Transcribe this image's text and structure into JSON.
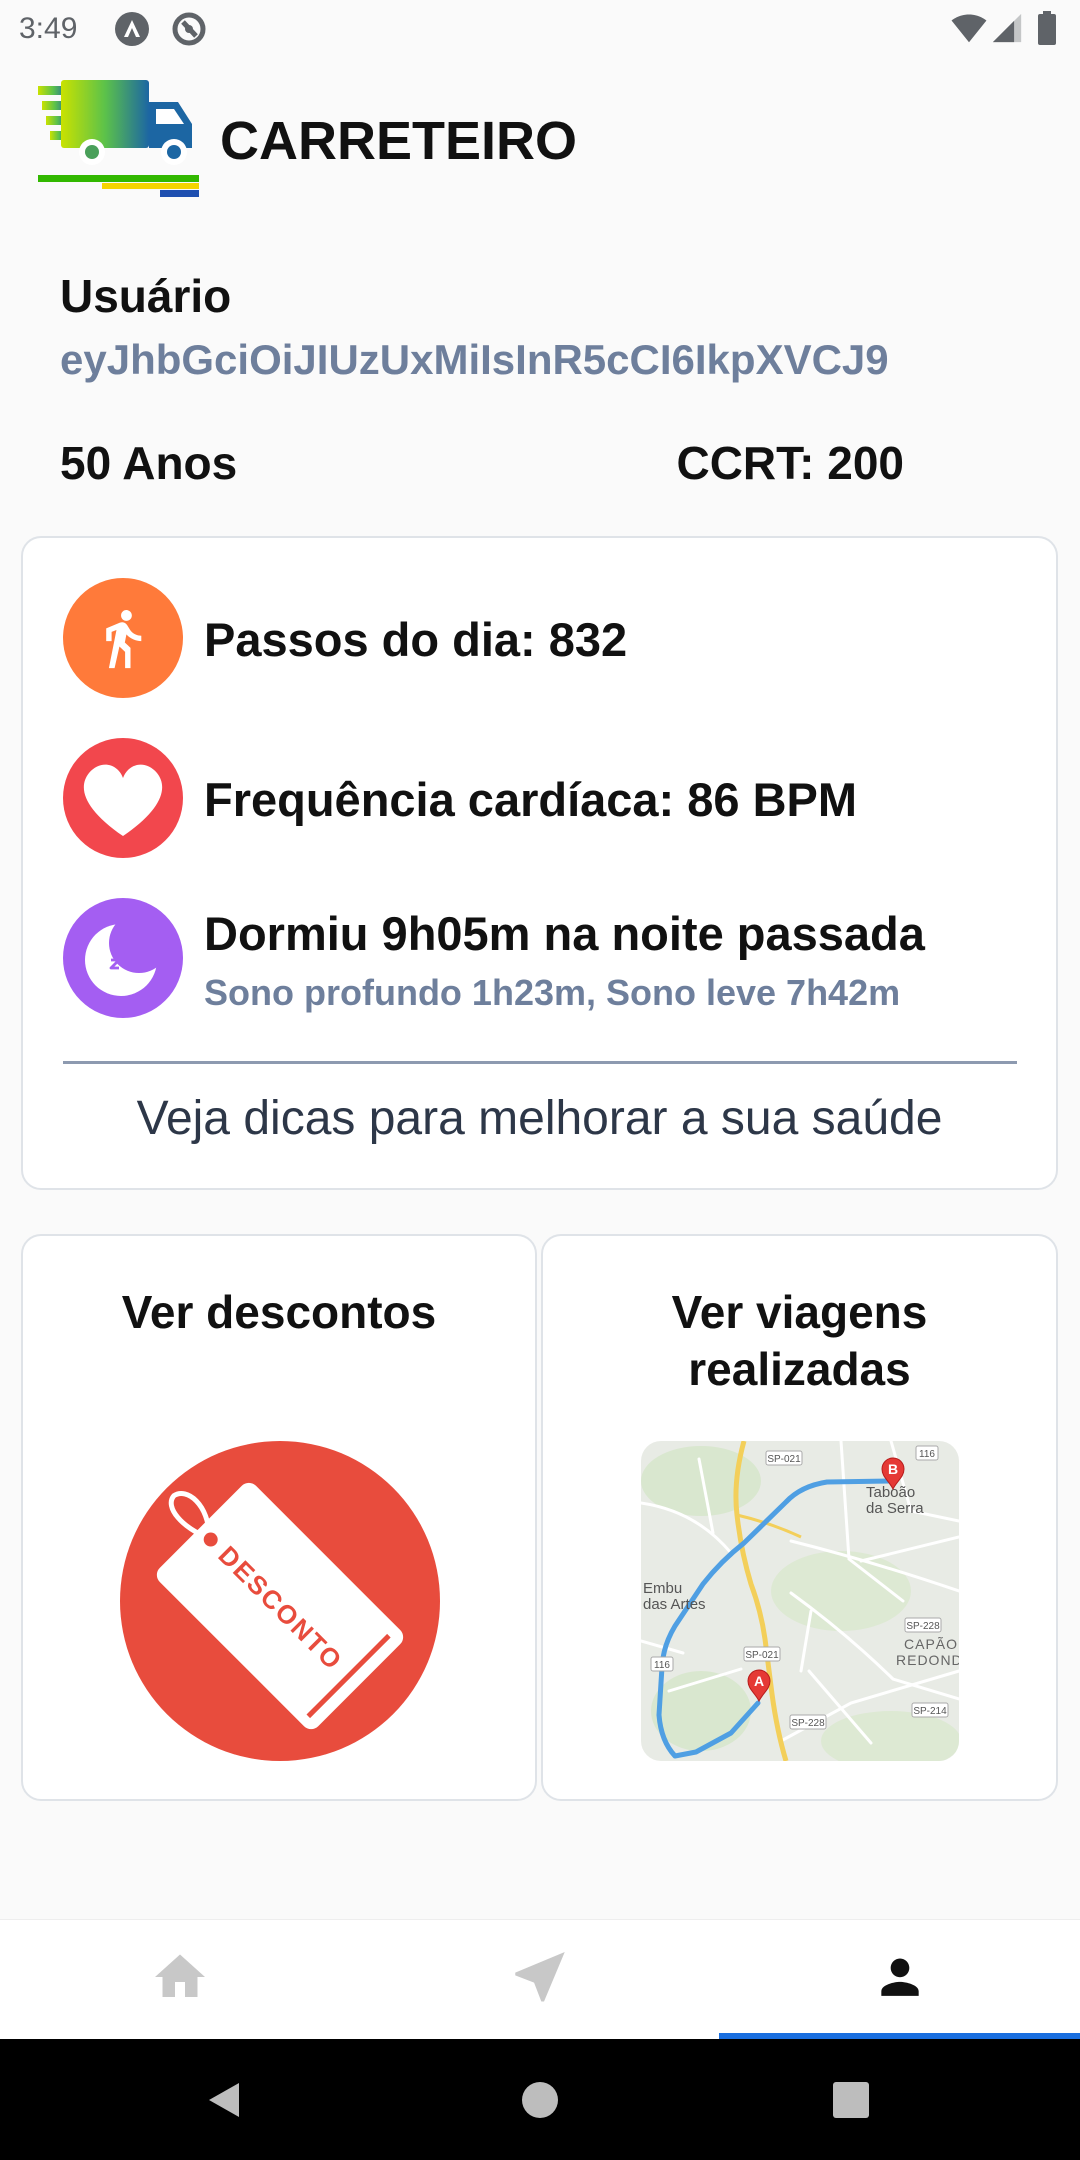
{
  "status_bar": {
    "time": "3:49",
    "icons": [
      "app-notification-icon",
      "sync-notification-icon",
      "wifi-icon",
      "cell-signal-icon",
      "battery-icon"
    ]
  },
  "header": {
    "logo_icon": "truck-logo-icon",
    "title": "CARRETEIRO"
  },
  "profile": {
    "user_label": "Usuário",
    "user_id": "eyJhbGciOiJIUzUxMiIsInR5cCI6IkpXVCJ9",
    "age": "50 Anos",
    "ccrt": "CCRT: 200"
  },
  "health": {
    "steps": {
      "icon": "walking-person-icon",
      "color": "#ff7a3a",
      "text": "Passos do dia: 832"
    },
    "heart_rate": {
      "icon": "heart-icon",
      "color": "#f2474d",
      "text": "Frequência cardíaca: 86 BPM"
    },
    "sleep": {
      "icon": "moon-icon",
      "color": "#a45ef2",
      "text": "Dormiu 9h05m na noite passada",
      "detail": "Sono profundo 1h23m, Sono leve 7h42m"
    },
    "tips_link": "Veja dicas para melhorar a sua saúde"
  },
  "shortcuts": {
    "discounts": {
      "title": "Ver descontos",
      "icon": "discount-tag-icon",
      "tag_text": "DESCONTO",
      "color": "#e84c3d"
    },
    "trips": {
      "title": "Ver viagens realizadas",
      "icon": "trip-route-map",
      "map": {
        "markers": {
          "start": "A",
          "end": "B"
        },
        "places": {
          "taboao_line1": "Taboão",
          "taboao_line2": "da Serra",
          "embu_line1": "Embu",
          "embu_line2": "das Artes",
          "capao_line1": "CAPÃO",
          "capao_line2": "REDOND"
        },
        "roads": [
          "SP-021",
          "116",
          "SP-228",
          "SP-021",
          "116",
          "SP-228",
          "SP-214"
        ],
        "route_color": "#4f9fe3"
      }
    }
  },
  "bottom_nav": {
    "items": [
      {
        "icon": "home-icon",
        "active": false
      },
      {
        "icon": "navigation-arrow-icon",
        "active": false
      },
      {
        "icon": "person-icon",
        "active": true
      }
    ],
    "active_color": "#1a6fe0"
  },
  "system_nav": {
    "icons": [
      "back-icon",
      "home-circle-icon",
      "recents-icon"
    ]
  }
}
